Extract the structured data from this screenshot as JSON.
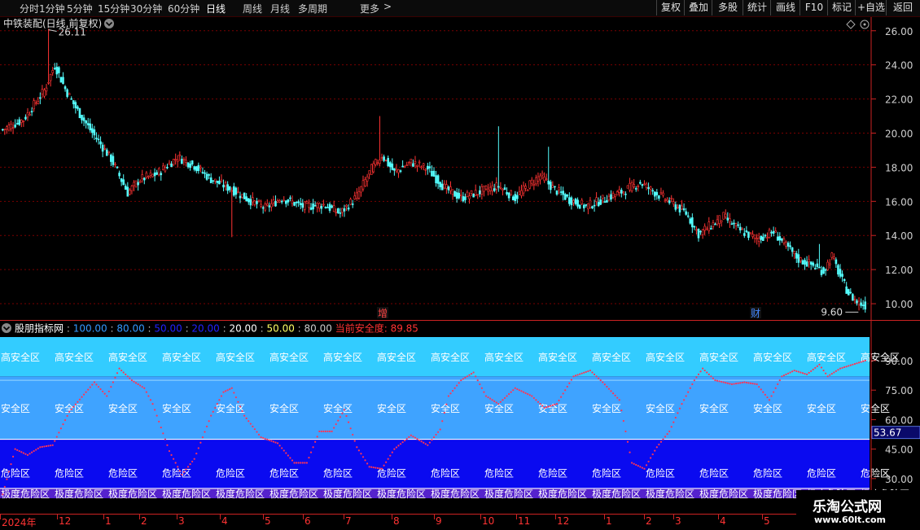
{
  "toolbar": {
    "periods": [
      "分时",
      "1分钟",
      "5分钟",
      "15分钟",
      "30分钟",
      "60分钟",
      "日线",
      "周线",
      "月线",
      "多周期",
      "更多"
    ],
    "active_period": "日线",
    "more_arrow": ">",
    "buttons": [
      "复权",
      "叠加",
      "多股",
      "统计",
      "画线",
      "F10",
      "标记",
      "+自选",
      "返回"
    ]
  },
  "main": {
    "title": "中铁装配(日线,前复权)",
    "high_label": "26.11",
    "low_label": "9.60",
    "y_ticks": [
      "26.00",
      "24.00",
      "22.00",
      "20.00",
      "18.00",
      "16.00",
      "14.00",
      "12.00",
      "10.00"
    ],
    "markers": [
      {
        "text": "增"
      },
      {
        "text": "财"
      }
    ],
    "colors": {
      "up": "#ff3333",
      "down": "#54fcfc",
      "grid": "#7a0000",
      "axis": "#cc2222",
      "label": "#cfcfcf"
    }
  },
  "indicator": {
    "title": "股朋指标网",
    "levels": [
      "100.00",
      "80.00",
      "50.00",
      "20.00",
      "20.00",
      "50.00",
      "80.00"
    ],
    "level_colors": [
      "#3399ff",
      "#3399ff",
      "#2222ff",
      "#2222ff",
      "#ffffff",
      "#ffff66",
      "#cccccc"
    ],
    "current_label": "当前安全度:",
    "current_value": "89.85",
    "zones": {
      "high": "高安全区",
      "safe": "安全区",
      "danger": "危险区",
      "extreme": "极度危险区"
    },
    "zone_colors": {
      "high": "#33ccff",
      "safe": "#3fa3ff",
      "danger": "#0a0af0",
      "extreme": "#5522cc"
    },
    "y_ticks": [
      "90.00",
      "75.00",
      "60.00",
      "45.00",
      "30.00"
    ],
    "current_box": "53.67"
  },
  "xaxis": {
    "labels": [
      "2024年",
      "12",
      "1",
      "2",
      "3",
      "4",
      "5",
      "6",
      "7",
      "8",
      "9",
      "10",
      "11",
      "12",
      "1",
      "2",
      "3",
      "4",
      "5"
    ]
  },
  "logo": {
    "line1": "乐淘公式网",
    "line2": "www.60lt.com"
  },
  "chart_data": {
    "type": "candlestick",
    "title": "中铁装配(日线,前复权)",
    "ylim": [
      9.0,
      26.8
    ],
    "y_ticks": [
      26,
      24,
      22,
      20,
      18,
      16,
      14,
      12,
      10
    ],
    "high": 26.11,
    "low": 9.6,
    "close_anchors": [
      [
        0,
        20.2
      ],
      [
        10,
        20.8
      ],
      [
        20,
        22.5
      ],
      [
        25,
        24.0
      ],
      [
        30,
        22.6
      ],
      [
        35,
        21.5
      ],
      [
        42,
        20.2
      ],
      [
        52,
        18.5
      ],
      [
        60,
        16.5
      ],
      [
        66,
        17.3
      ],
      [
        74,
        17.6
      ],
      [
        84,
        18.6
      ],
      [
        92,
        18.1
      ],
      [
        100,
        17.3
      ],
      [
        110,
        16.7
      ],
      [
        118,
        16.1
      ],
      [
        126,
        15.6
      ],
      [
        134,
        16.2
      ],
      [
        144,
        15.7
      ],
      [
        154,
        15.8
      ],
      [
        162,
        15.3
      ],
      [
        170,
        16.3
      ],
      [
        177,
        17.9
      ],
      [
        182,
        18.7
      ],
      [
        188,
        17.7
      ],
      [
        196,
        18.3
      ],
      [
        204,
        17.9
      ],
      [
        212,
        16.8
      ],
      [
        220,
        16.2
      ],
      [
        230,
        16.6
      ],
      [
        238,
        16.9
      ],
      [
        246,
        16.2
      ],
      [
        252,
        16.9
      ],
      [
        258,
        17.5
      ],
      [
        264,
        16.8
      ],
      [
        272,
        16.1
      ],
      [
        280,
        15.7
      ],
      [
        290,
        16.2
      ],
      [
        298,
        16.6
      ],
      [
        306,
        17.1
      ],
      [
        312,
        16.6
      ],
      [
        320,
        16.0
      ],
      [
        328,
        15.3
      ],
      [
        334,
        14.1
      ],
      [
        340,
        14.6
      ],
      [
        346,
        15.1
      ],
      [
        354,
        14.3
      ],
      [
        362,
        13.8
      ],
      [
        370,
        14.2
      ],
      [
        376,
        13.4
      ],
      [
        382,
        12.6
      ],
      [
        388,
        12.3
      ],
      [
        394,
        11.9
      ],
      [
        398,
        12.8
      ],
      [
        402,
        11.6
      ],
      [
        406,
        10.6
      ],
      [
        410,
        10.1
      ],
      [
        414,
        9.9
      ]
    ],
    "spikes": [
      {
        "i": 22,
        "h": 26.11
      },
      {
        "i": 181,
        "h": 21.0
      },
      {
        "i": 238,
        "h": 20.4
      },
      {
        "i": 262,
        "h": 19.2
      },
      {
        "i": 110,
        "l": 13.9
      },
      {
        "i": 392,
        "h": 13.5
      }
    ],
    "oscillator": {
      "ylim": [
        20,
        102
      ],
      "bands": [
        {
          "name": "高安全区",
          "from": 82,
          "to": 102
        },
        {
          "name": "安全区",
          "from": 50,
          "to": 82
        },
        {
          "name": "危险区",
          "from": 25,
          "to": 50
        },
        {
          "name": "极度危险区",
          "from": 20,
          "to": 25
        }
      ],
      "current": 89.85,
      "anchors": [
        [
          0,
          22
        ],
        [
          6,
          45
        ],
        [
          12,
          42
        ],
        [
          18,
          46
        ],
        [
          24,
          47
        ],
        [
          32,
          64
        ],
        [
          40,
          74
        ],
        [
          44,
          79
        ],
        [
          50,
          72
        ],
        [
          56,
          86
        ],
        [
          62,
          80
        ],
        [
          68,
          76
        ],
        [
          72,
          68
        ],
        [
          80,
          44
        ],
        [
          86,
          32
        ],
        [
          92,
          40
        ],
        [
          100,
          62
        ],
        [
          106,
          74
        ],
        [
          110,
          76
        ],
        [
          116,
          62
        ],
        [
          124,
          51
        ],
        [
          132,
          48
        ],
        [
          140,
          38
        ],
        [
          146,
          38
        ],
        [
          152,
          54
        ],
        [
          158,
          54
        ],
        [
          164,
          65
        ],
        [
          170,
          46
        ],
        [
          176,
          36
        ],
        [
          182,
          35
        ],
        [
          188,
          45
        ],
        [
          196,
          52
        ],
        [
          204,
          47
        ],
        [
          210,
          55
        ],
        [
          214,
          72
        ],
        [
          220,
          80
        ],
        [
          226,
          84
        ],
        [
          232,
          72
        ],
        [
          238,
          68
        ],
        [
          246,
          76
        ],
        [
          254,
          72
        ],
        [
          260,
          66
        ],
        [
          266,
          68
        ],
        [
          274,
          82
        ],
        [
          282,
          85
        ],
        [
          288,
          79
        ],
        [
          296,
          70
        ],
        [
          302,
          38
        ],
        [
          308,
          35
        ],
        [
          314,
          46
        ],
        [
          320,
          54
        ],
        [
          326,
          68
        ],
        [
          332,
          80
        ],
        [
          336,
          86
        ],
        [
          342,
          80
        ],
        [
          350,
          78
        ],
        [
          356,
          79
        ],
        [
          362,
          78
        ],
        [
          368,
          70
        ],
        [
          374,
          82
        ],
        [
          380,
          85
        ],
        [
          386,
          83
        ],
        [
          392,
          88
        ],
        [
          396,
          82
        ],
        [
          402,
          86
        ],
        [
          408,
          88
        ],
        [
          414,
          90
        ]
      ]
    }
  }
}
